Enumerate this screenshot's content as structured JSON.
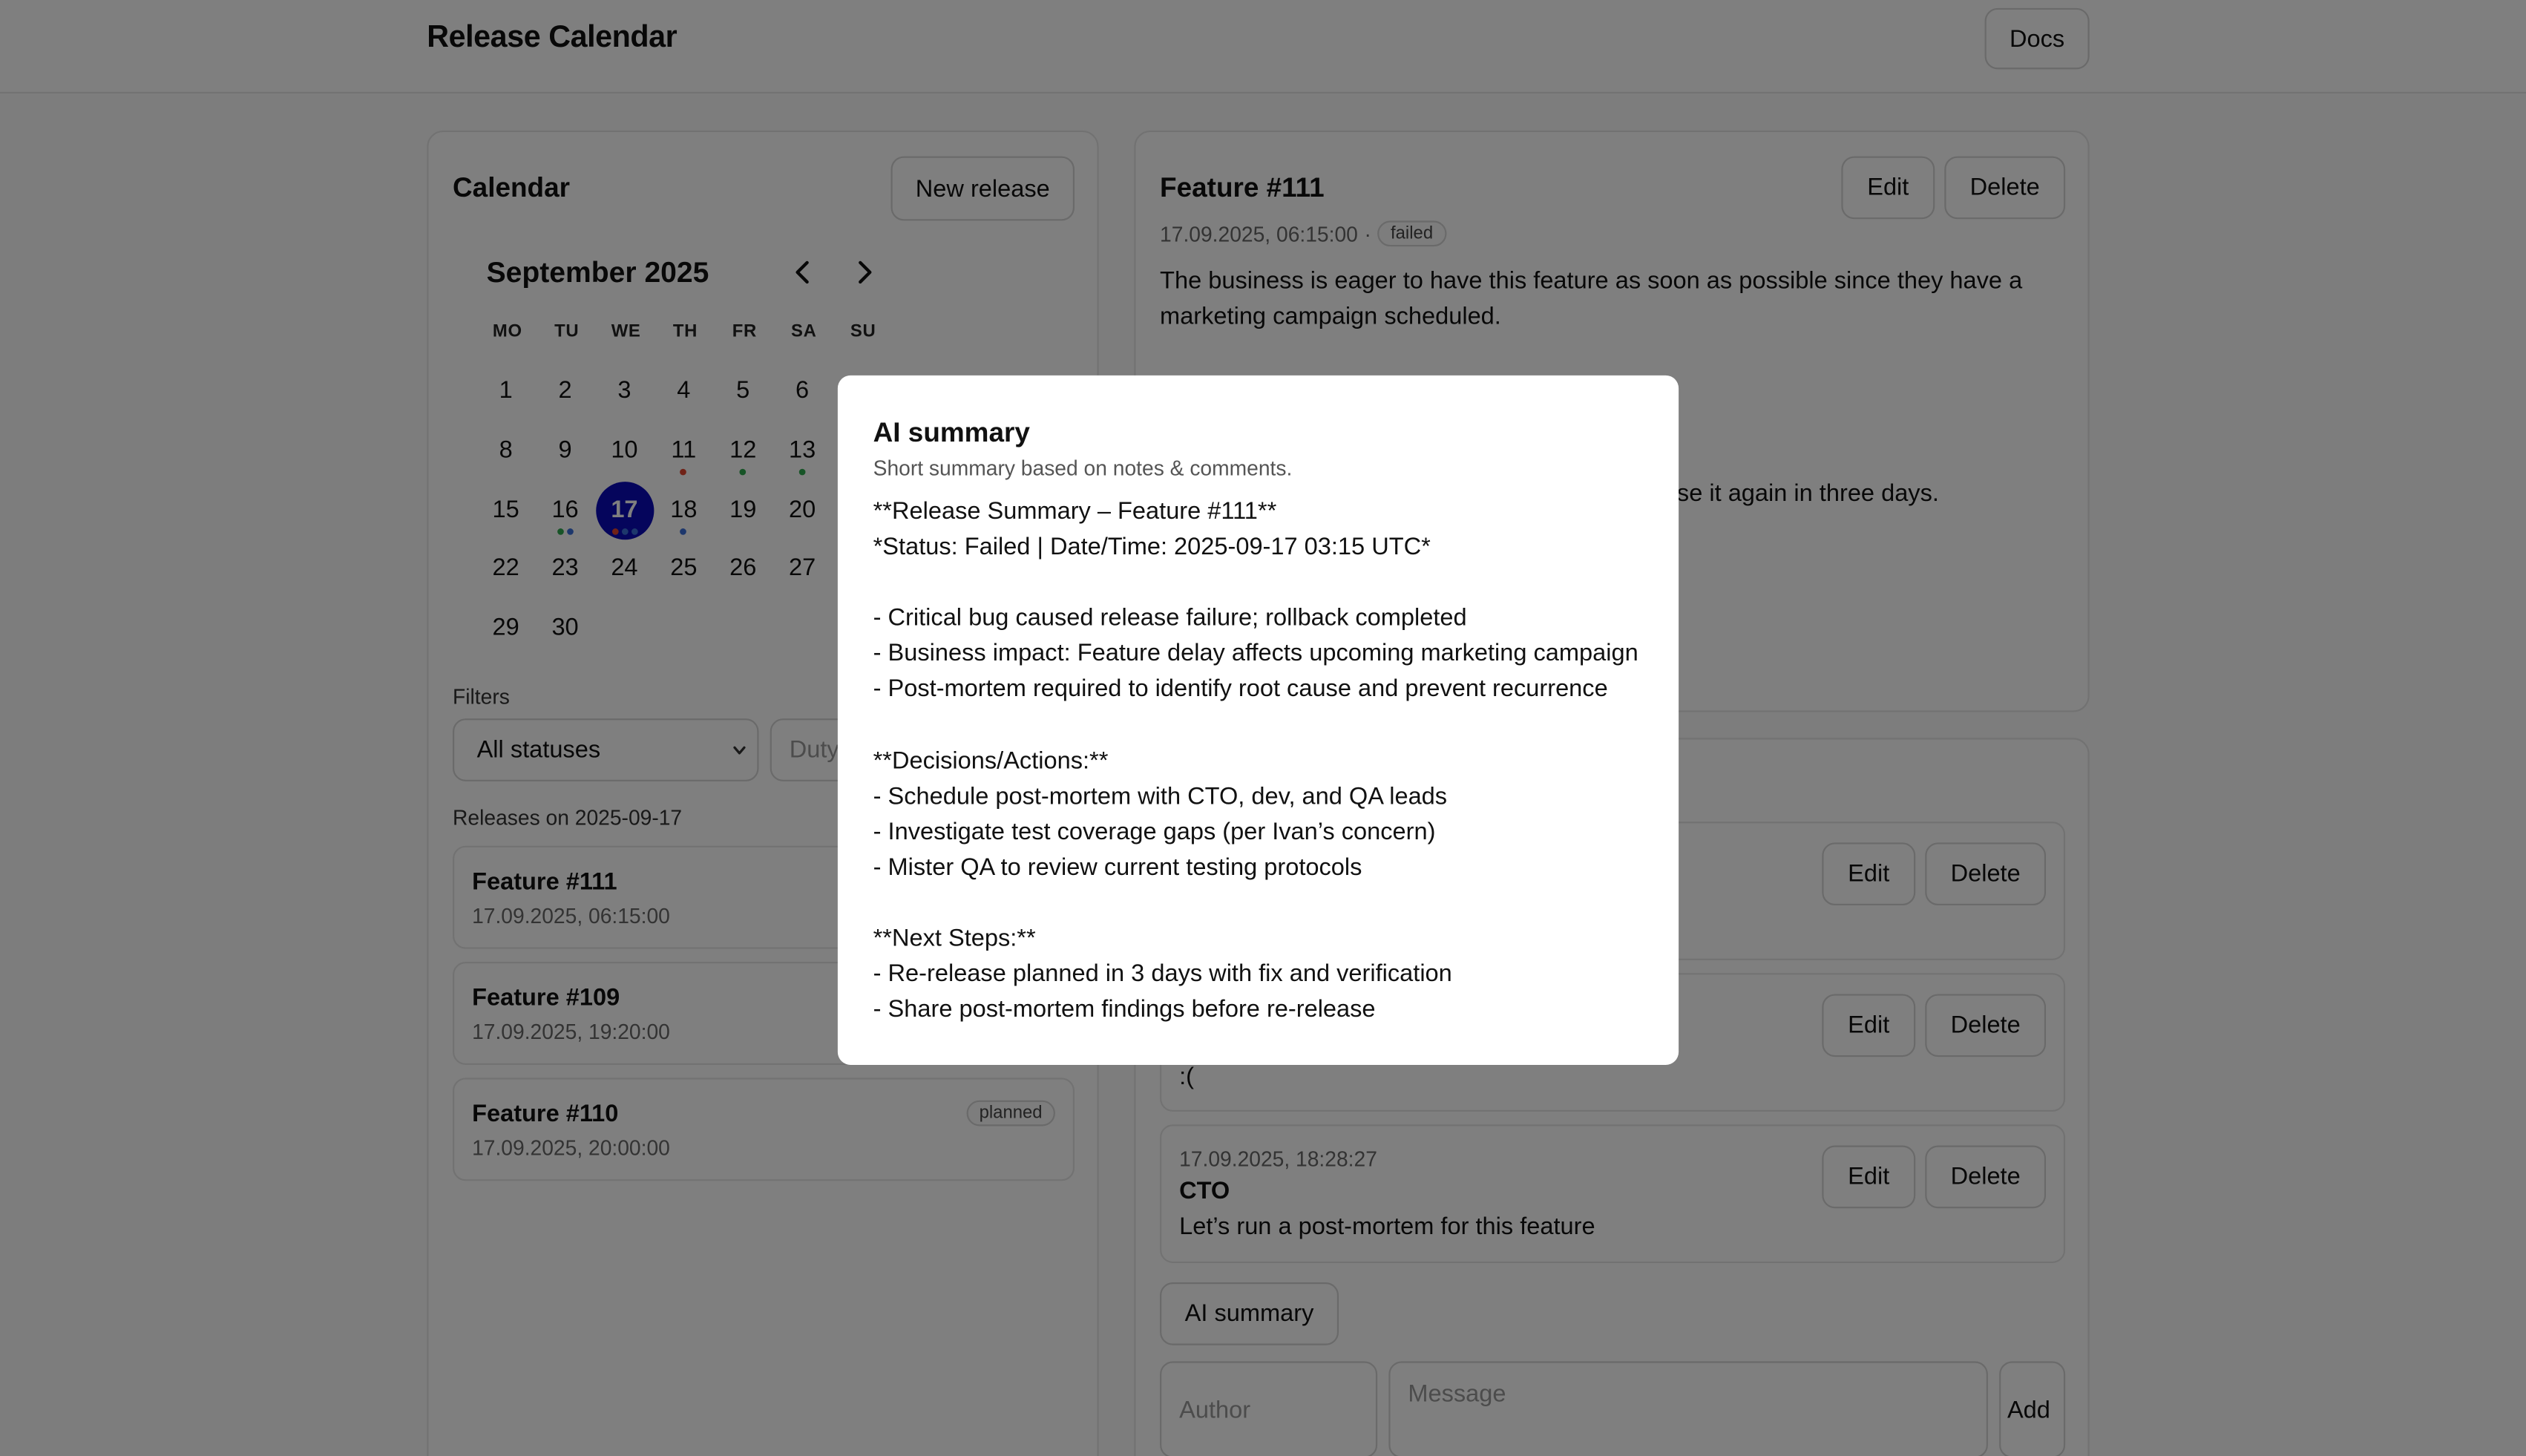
{
  "header": {
    "title": "Release Calendar",
    "docs_label": "Docs"
  },
  "calendar": {
    "title": "Calendar",
    "new_release_label": "New release",
    "month_label": "September 2025",
    "prev_icon": "chevron-left-icon",
    "next_icon": "chevron-right-icon",
    "weekdays": [
      "MO",
      "TU",
      "WE",
      "TH",
      "FR",
      "SA",
      "SU"
    ],
    "first_weekday_offset": 0,
    "days_in_month": 30,
    "selected_day": 17,
    "day_dots": {
      "11": [
        "#e0442e"
      ],
      "12": [
        "#2fa84f"
      ],
      "13": [
        "#2fa84f"
      ],
      "16": [
        "#2fa84f",
        "#3a6fd8"
      ],
      "17": [
        "#e0442e",
        "#3a6fd8",
        "#3a6fd8"
      ],
      "18": [
        "#3a6fd8"
      ]
    }
  },
  "filters": {
    "label": "Filters",
    "status_value": "All statuses",
    "duty_placeholder": "Duty"
  },
  "releases": {
    "label": "Releases on 2025-09-17",
    "items": [
      {
        "title": "Feature #111",
        "date": "17.09.2025, 06:15:00",
        "status": ""
      },
      {
        "title": "Feature #109",
        "date": "17.09.2025, 19:20:00",
        "status": ""
      },
      {
        "title": "Feature #110",
        "date": "17.09.2025, 20:00:00",
        "status": "planned"
      }
    ]
  },
  "detail": {
    "title": "Feature #111",
    "edit_label": "Edit",
    "delete_label": "Delete",
    "datetime": "17.09.2025, 06:15:00",
    "separator": "·",
    "status": "failed",
    "description": "The business is eager to have this feature as soon as possible since they have a marketing campaign scheduled.",
    "note_fragment": "se it again in three days."
  },
  "comments": {
    "edit_label": "Edit",
    "delete_label": "Delete",
    "items": [
      {
        "date": "",
        "author": "",
        "text": ""
      },
      {
        "date": "",
        "author": "",
        "text": ":("
      },
      {
        "date": "17.09.2025, 18:28:27",
        "author": "CTO",
        "text": "Let’s run a post-mortem for this feature"
      }
    ],
    "ai_summary_label": "AI summary",
    "author_placeholder": "Author",
    "message_placeholder": "Message",
    "add_label": "Add"
  },
  "modal": {
    "title": "AI summary",
    "subtitle": "Short summary based on notes & comments.",
    "lines": [
      "**Release Summary – Feature #111**",
      "*Status: Failed | Date/Time: 2025-09-17 03:15 UTC*",
      "",
      "- Critical bug caused release failure; rollback completed",
      "- Business impact: Feature delay affects upcoming marketing campaign",
      "- Post-mortem required to identify root cause and prevent recurrence",
      "",
      "**Decisions/Actions:**",
      "- Schedule post-mortem with CTO, dev, and QA leads",
      "- Investigate test coverage gaps (per Ivan’s concern)",
      "- Mister QA to review current testing protocols",
      "",
      "**Next Steps:**",
      "- Re-release planned in 3 days with fix and verification",
      "- Share post-mortem findings before re-release"
    ]
  }
}
